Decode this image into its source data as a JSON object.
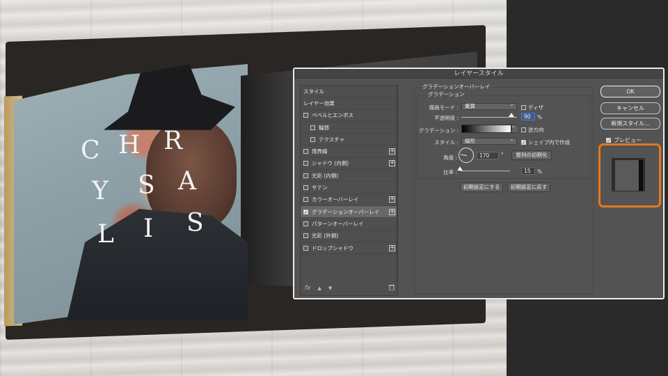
{
  "background": {
    "cover_letters": [
      {
        "ch": "C"
      },
      {
        "ch": "H"
      },
      {
        "ch": "R"
      },
      {
        "ch": "Y"
      },
      {
        "ch": "S"
      },
      {
        "ch": "A"
      },
      {
        "ch": "L"
      },
      {
        "ch": "I"
      },
      {
        "ch": "S"
      }
    ]
  },
  "dialog": {
    "title": "レイヤースタイル",
    "effects": [
      {
        "label": "スタイル",
        "checkbox": false,
        "checked": false,
        "plus": false,
        "indent": false,
        "selected": false
      },
      {
        "label": "レイヤー効果",
        "checkbox": false,
        "checked": false,
        "plus": false,
        "indent": false,
        "selected": false
      },
      {
        "label": "ベベルとエンボス",
        "checkbox": true,
        "checked": false,
        "plus": false,
        "indent": false,
        "selected": false
      },
      {
        "label": "輪郭",
        "checkbox": true,
        "checked": false,
        "plus": false,
        "indent": true,
        "selected": false
      },
      {
        "label": "テクスチャ",
        "checkbox": true,
        "checked": false,
        "plus": false,
        "indent": true,
        "selected": false
      },
      {
        "label": "境界線",
        "checkbox": true,
        "checked": false,
        "plus": true,
        "indent": false,
        "selected": false
      },
      {
        "label": "シャドウ (内側)",
        "checkbox": true,
        "checked": false,
        "plus": true,
        "indent": false,
        "selected": false
      },
      {
        "label": "光彩 (内側)",
        "checkbox": true,
        "checked": false,
        "plus": false,
        "indent": false,
        "selected": false
      },
      {
        "label": "サテン",
        "checkbox": true,
        "checked": false,
        "plus": false,
        "indent": false,
        "selected": false
      },
      {
        "label": "カラーオーバーレイ",
        "checkbox": true,
        "checked": false,
        "plus": true,
        "indent": false,
        "selected": false
      },
      {
        "label": "グラデーションオーバーレイ",
        "checkbox": true,
        "checked": true,
        "plus": true,
        "indent": false,
        "selected": true
      },
      {
        "label": "パターンオーバーレイ",
        "checkbox": true,
        "checked": false,
        "plus": false,
        "indent": false,
        "selected": false
      },
      {
        "label": "光彩 (外側)",
        "checkbox": true,
        "checked": false,
        "plus": false,
        "indent": false,
        "selected": false
      },
      {
        "label": "ドロップシャドウ",
        "checkbox": true,
        "checked": false,
        "plus": true,
        "indent": false,
        "selected": false
      }
    ],
    "footer": {
      "fx": "fx",
      "up": "▲",
      "down": "▼",
      "trash": "🗑"
    },
    "settings": {
      "group_title": "グラデーションオーバーレイ",
      "sub_title": "グラデーション",
      "blend_mode_label": "描画モード :",
      "blend_mode_value": "乗算",
      "dither_label": "ディザ",
      "dither_checked": false,
      "opacity_label": "不透明度 :",
      "opacity_value": "90",
      "opacity_unit": "%",
      "opacity_fraction": 0.9,
      "gradient_label": "グラデーション :",
      "reverse_label": "逆方向",
      "reverse_checked": false,
      "style_label": "スタイル :",
      "style_value": "線形",
      "align_layer_label": "シェイプ内で作成",
      "align_layer_checked": true,
      "angle_label": "角度 :",
      "angle_value": "170",
      "angle_unit": "°",
      "reset_alignment_label": "整列の初期化",
      "scale_label": "比率 :",
      "scale_value": "15",
      "scale_unit": "%",
      "scale_fraction": 0.0,
      "make_default_label": "初期設定にする",
      "reset_default_label": "初期設定に戻す"
    },
    "buttons": {
      "ok": "OK",
      "cancel": "キャンセル",
      "new_style": "新規スタイル...",
      "preview_label": "プレビュー",
      "preview_checked": true
    }
  },
  "colors": {
    "highlight": "#e8781c",
    "dialog_bg": "#535353"
  }
}
